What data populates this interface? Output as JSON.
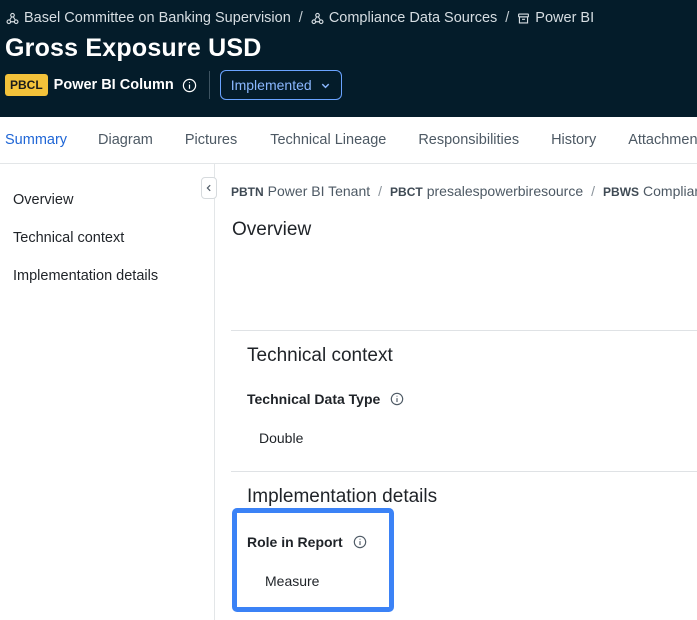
{
  "header": {
    "breadcrumbs": [
      {
        "label": "Basel Committee on Banking Supervision",
        "icon": "share-nodes-icon"
      },
      {
        "label": "Compliance Data Sources",
        "icon": "share-nodes-icon"
      },
      {
        "label": "Power BI",
        "icon": "archive-box-icon"
      }
    ],
    "breadcrumb_separator": "/",
    "title": "Gross Exposure USD",
    "type_badge": "PBCL",
    "type_label": "Power BI Column",
    "status": "Implemented"
  },
  "tabs": [
    "Summary",
    "Diagram",
    "Pictures",
    "Technical Lineage",
    "Responsibilities",
    "History",
    "Attachments"
  ],
  "active_tab": "Summary",
  "sidebar": {
    "items": [
      "Overview",
      "Technical context",
      "Implementation details"
    ]
  },
  "path": {
    "items": [
      {
        "abbr": "PBTN",
        "label": "Power BI Tenant"
      },
      {
        "abbr": "PBCT",
        "label": "presalespowerbiresource"
      },
      {
        "abbr": "PBWS",
        "label": "Compliance"
      }
    ],
    "separator": "/"
  },
  "overview": {
    "title": "Overview"
  },
  "technical_context": {
    "title": "Technical context",
    "field_label": "Technical Data Type",
    "field_value": "Double"
  },
  "implementation": {
    "title": "Implementation details",
    "field_label": "Role in Report",
    "field_value": "Measure"
  },
  "colors": {
    "header_bg": "#041c2a",
    "accent": "#1f66d6",
    "badge": "#f3c23a",
    "highlight": "#3b82f6"
  }
}
